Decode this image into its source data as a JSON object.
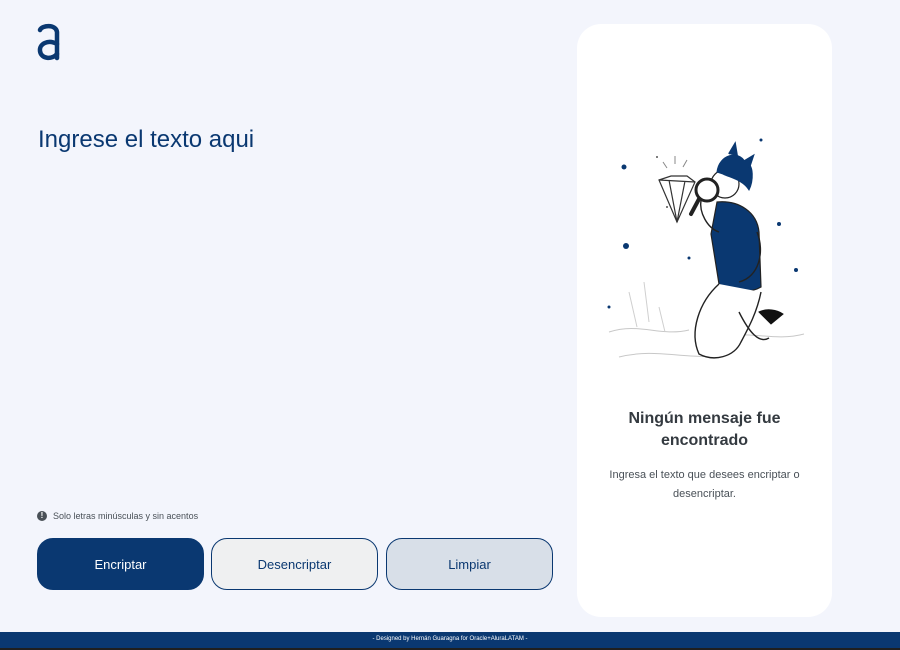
{
  "input": {
    "placeholder": "Ingrese el texto aqui",
    "value": ""
  },
  "hint": {
    "icon": "info-icon",
    "symbol": "!",
    "text": "Solo letras minúsculas y sin acentos"
  },
  "buttons": {
    "encrypt_label": "Encriptar",
    "decrypt_label": "Desencriptar",
    "clear_label": "Limpiar"
  },
  "output": {
    "title": "Ningún mensaje fue encontrado",
    "text": "Ingresa el texto que desees encriptar o desencriptar."
  },
  "footer": {
    "text": "- Designed by Hernán Guaragna for Oracle+AluraLATAM -"
  },
  "colors": {
    "primary": "#0a3871",
    "background": "#f3f5fc",
    "card": "#ffffff",
    "clear_button_bg": "#d8dfe8",
    "decrypt_button_bg": "#eff0f1"
  }
}
